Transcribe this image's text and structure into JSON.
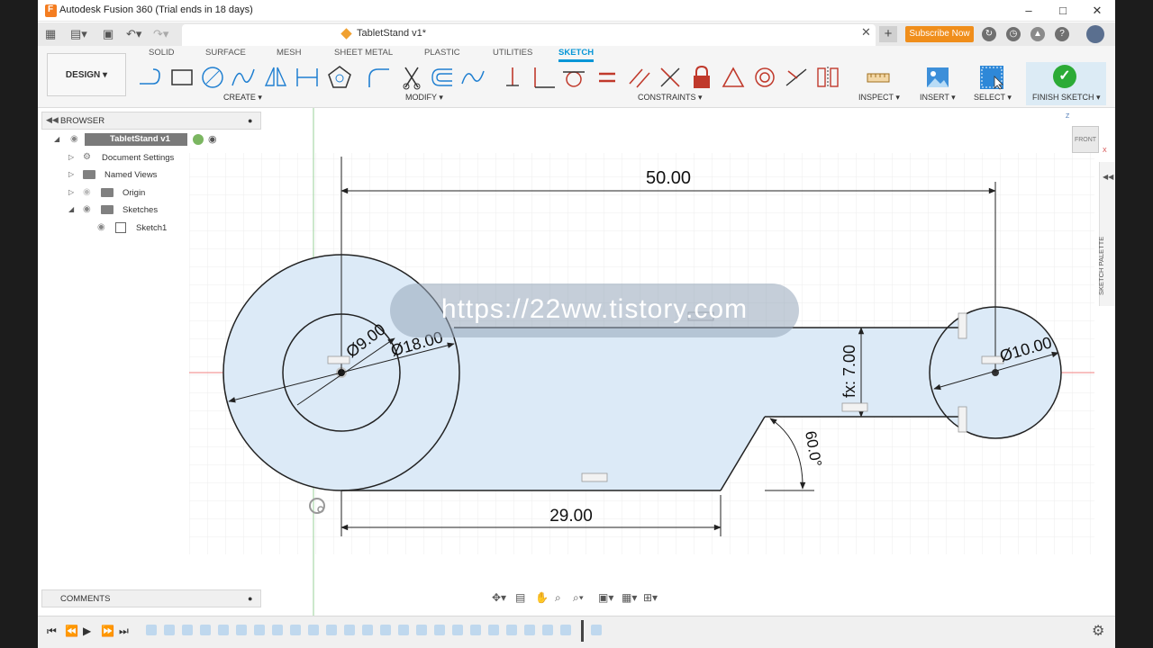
{
  "window": {
    "title": "Autodesk Fusion 360 (Trial ends in 18 days)"
  },
  "header": {
    "document_title": "TabletStand v1*",
    "subscribe_label": "Subscribe Now",
    "workspace_label": "DESIGN ▾",
    "tabs": [
      "SOLID",
      "SURFACE",
      "MESH",
      "SHEET METAL",
      "PLASTIC",
      "UTILITIES",
      "SKETCH"
    ],
    "active_tab": "SKETCH",
    "groups": [
      "CREATE ▾",
      "MODIFY ▾",
      "CONSTRAINTS ▾",
      "INSPECT ▾",
      "INSERT ▾",
      "SELECT ▾",
      "FINISH SKETCH ▾"
    ]
  },
  "browser": {
    "title": "BROWSER",
    "items": [
      {
        "label": "TabletStand v1"
      },
      {
        "label": "Document Settings"
      },
      {
        "label": "Named Views"
      },
      {
        "label": "Origin"
      },
      {
        "label": "Sketches"
      },
      {
        "label": "Sketch1"
      }
    ]
  },
  "comments": {
    "title": "COMMENTS"
  },
  "viewcube": {
    "label": "FRONT",
    "axis_z": "Z",
    "axis_x": "X"
  },
  "palette": {
    "label": "SKETCH PALETTE"
  },
  "sketch": {
    "dim_top": "50.00",
    "dim_bottom": "29.00",
    "dim_height": "fx: 7.00",
    "dim_angle": "60.0°",
    "dim_d9": "Ø9.00",
    "dim_d18": "Ø18.00",
    "dim_d10": "Ø10.00"
  },
  "watermark": "https://22ww.tistory.com",
  "colors": {
    "accent": "#0696d7",
    "finish_green": "#2cab36",
    "subscribe": "#f08e1b",
    "sketch_fill": "#dceaf7"
  }
}
